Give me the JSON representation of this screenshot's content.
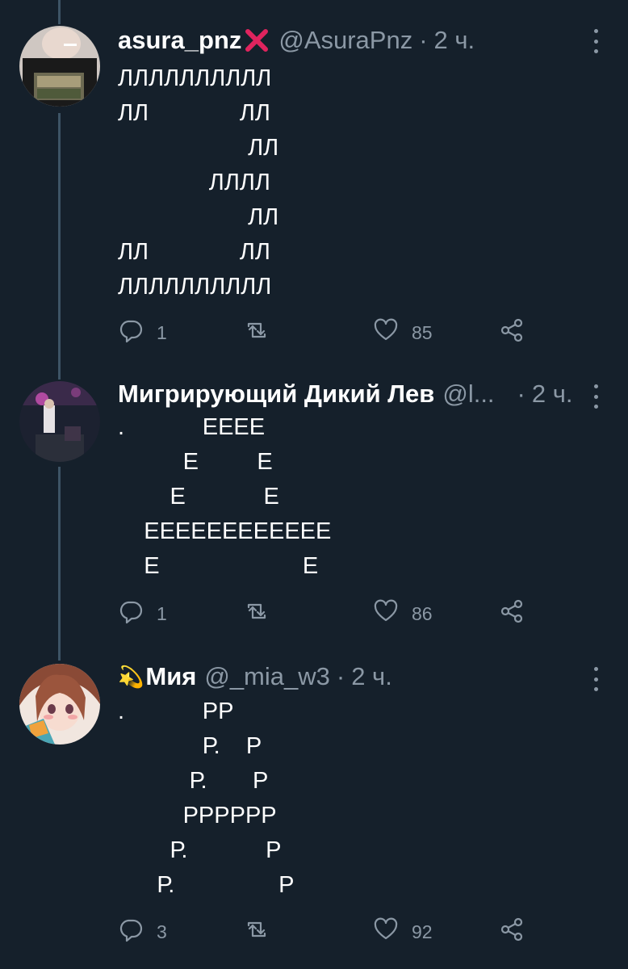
{
  "tweets": [
    {
      "display_name": "asura_pnz",
      "name_emoji": "❌",
      "handle": "@AsuraPnz",
      "separator": "·",
      "time": "2 ч.",
      "text": "ЛЛЛЛЛЛЛЛЛЛ\nЛЛ              ЛЛ\n                    ЛЛ\n              ЛЛЛЛ\n                    ЛЛ\nЛЛ              ЛЛ\nЛЛЛЛЛЛЛЛЛЛ",
      "replies": "1",
      "retweets": "",
      "likes": "85"
    },
    {
      "display_name": "Мигрирующий Дикий Лев",
      "name_emoji": "",
      "handle": "@l...",
      "separator": "·",
      "time": "2 ч.",
      "text": ".            ЕЕЕЕ\n          Е         Е\n        Е            Е\n    ЕЕЕЕЕЕЕЕЕЕЕЕ\n    Е                      Е",
      "replies": "1",
      "retweets": "",
      "likes": "86"
    },
    {
      "display_name": "Мия",
      "name_emoji": "💫",
      "handle": "@_mia_w3",
      "separator": "·",
      "time": "2 ч.",
      "text": ".            РР\n             Р.    Р\n           Р.       Р\n          РРРРРР\n        Р.            Р\n      Р.                Р",
      "replies": "3",
      "retweets": "",
      "likes": "92"
    }
  ],
  "icons": {
    "reply": "reply-icon",
    "retweet": "retweet-icon",
    "like": "heart-icon",
    "share": "share-icon",
    "more": "more-vertical-icon"
  },
  "colors": {
    "background": "#15202b",
    "secondary_text": "#8b98a5",
    "thread_line": "#3d5466",
    "x_mark": "#e0245e"
  }
}
